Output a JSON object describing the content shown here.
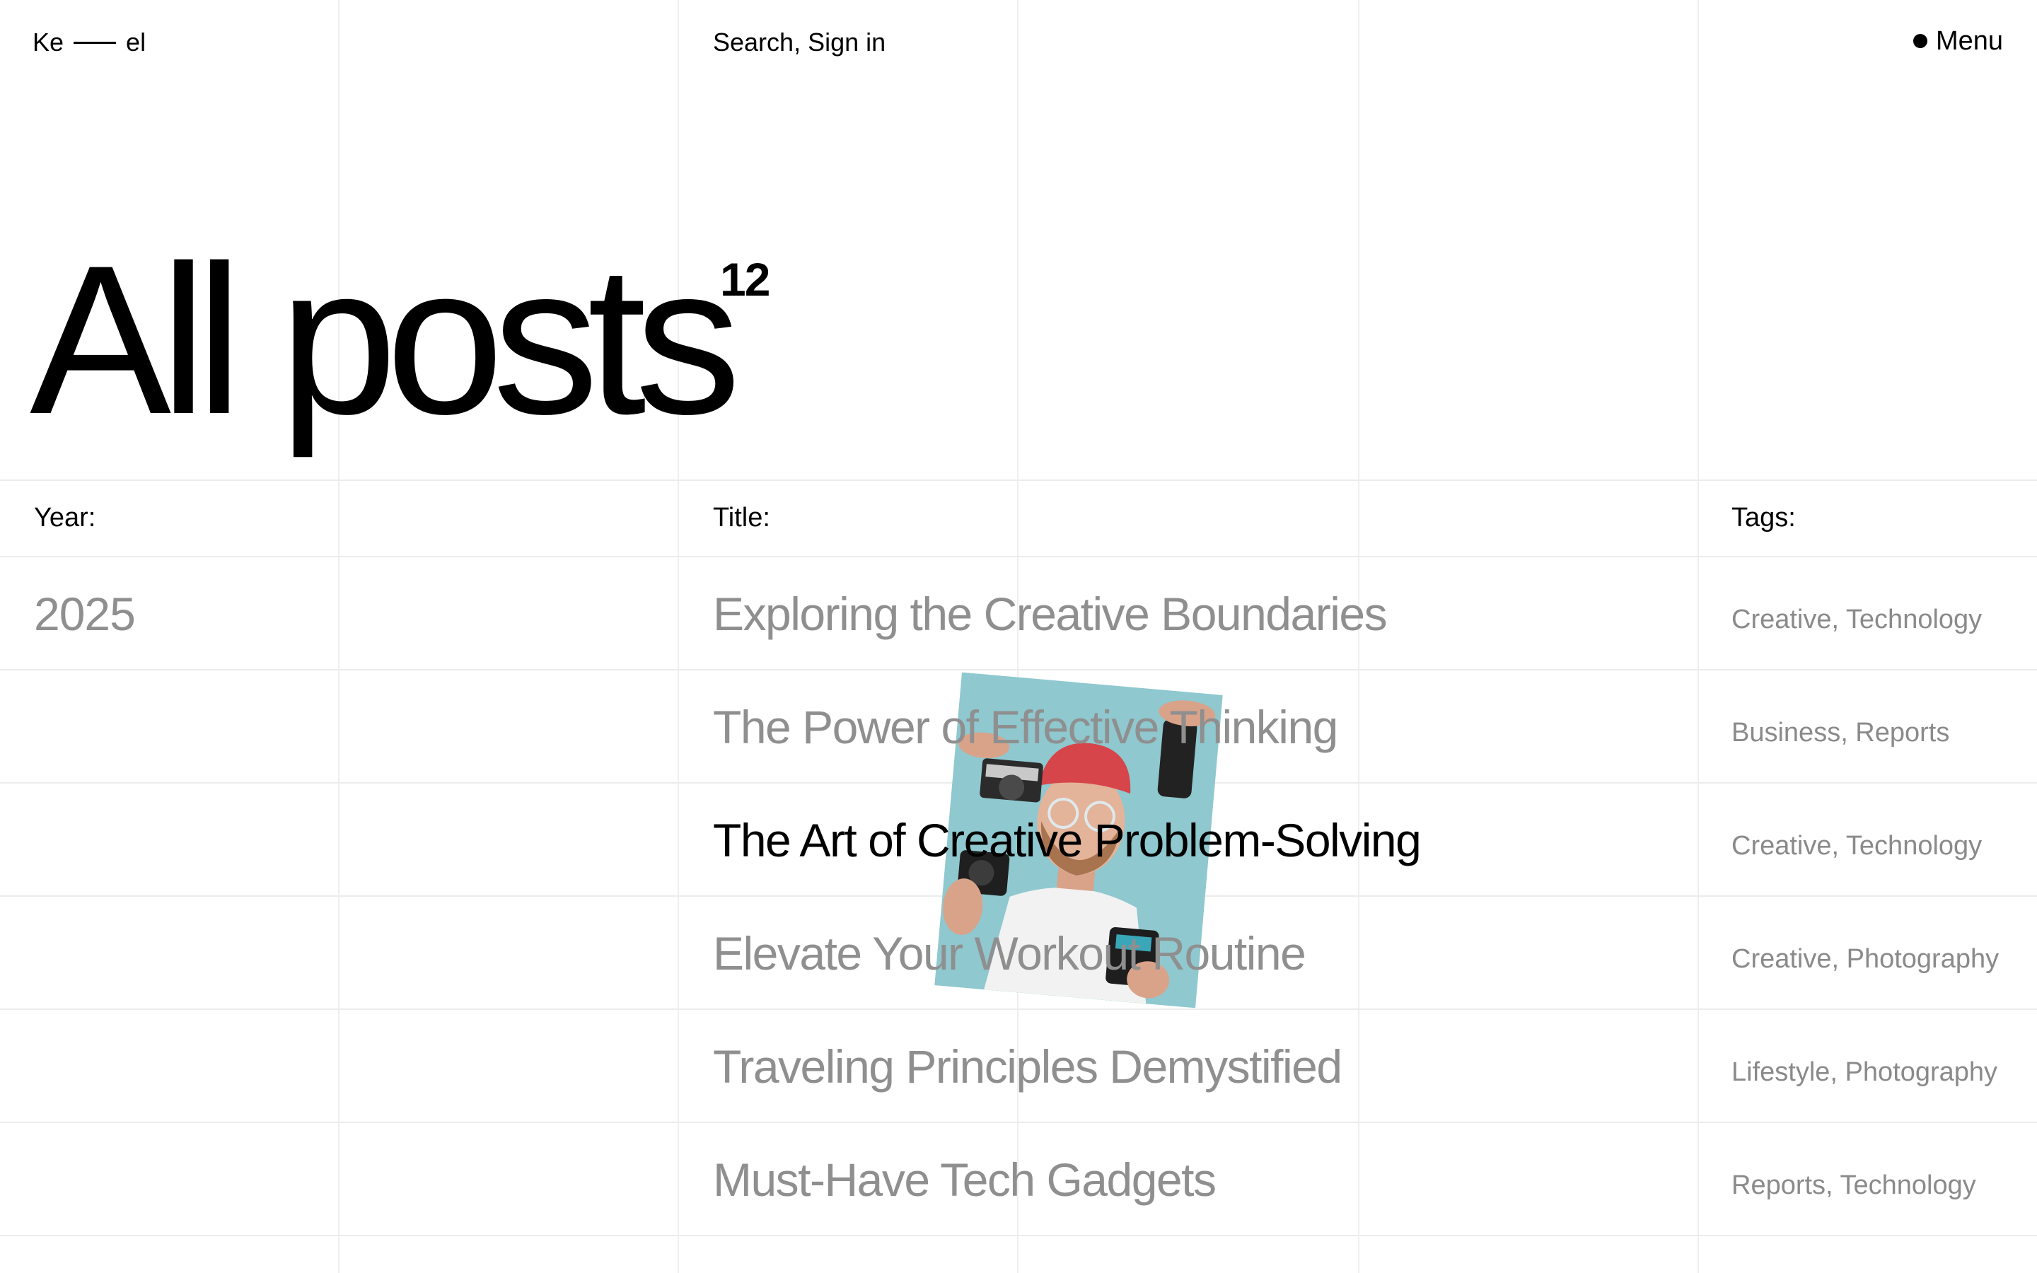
{
  "header": {
    "logo_left": "Ke",
    "logo_right": "el",
    "search_label": "Search",
    "separator": ", ",
    "signin_label": "Sign in",
    "menu_label": "Menu"
  },
  "hero": {
    "title": "All posts",
    "count": "12"
  },
  "columns": {
    "year": "Year:",
    "title": "Title:",
    "tags": "Tags:"
  },
  "posts": [
    {
      "year": "2025",
      "title": "Exploring the Creative Boundaries",
      "tags": "Creative, Technology"
    },
    {
      "year": "",
      "title": "The Power of Effective Thinking",
      "tags": "Business, Reports"
    },
    {
      "year": "",
      "title": "The Art of Creative Problem-Solving",
      "tags": "Creative, Technology"
    },
    {
      "year": "",
      "title": "Elevate Your Workout Routine",
      "tags": "Creative, Photography"
    },
    {
      "year": "",
      "title": "Traveling Principles Demystified",
      "tags": "Lifestyle, Photography"
    },
    {
      "year": "",
      "title": "Must-Have Tech Gadgets",
      "tags": "Reports, Technology"
    }
  ],
  "active_post_index": 2,
  "preview_image": {
    "subject": "man-with-cameras-photo",
    "background_color": "#8fc8cf"
  },
  "colors": {
    "text": "#000000",
    "muted": "#8f8f8f",
    "grid": "#efefef"
  }
}
